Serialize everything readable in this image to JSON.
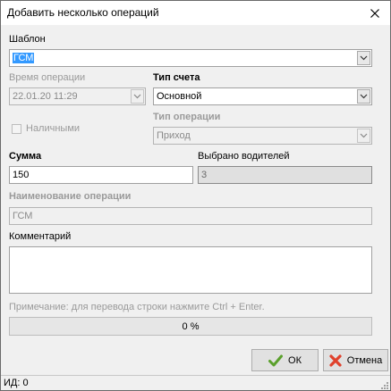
{
  "window": {
    "title": "Добавить несколько операций"
  },
  "template": {
    "label": "Шаблон",
    "value": "ГСМ"
  },
  "operation_time": {
    "label": "Время операции",
    "value": "22.01.20 11:29"
  },
  "account_type": {
    "label": "Тип счета",
    "value": "Основной"
  },
  "cash": {
    "label": "Наличными",
    "checked": false
  },
  "operation_type": {
    "label": "Тип операции",
    "value": "Приход"
  },
  "amount": {
    "label": "Сумма",
    "value": "150"
  },
  "drivers_selected": {
    "label": "Выбрано водителей",
    "value": "3"
  },
  "operation_name": {
    "label": "Наименование операции",
    "value": "ГСМ"
  },
  "comment": {
    "label": "Комментарий",
    "value": ""
  },
  "note": "Примечание: для перевода строки нажмите Ctrl + Enter.",
  "progress": {
    "text": "0 %",
    "value": 0
  },
  "buttons": {
    "ok": "ОК",
    "cancel": "Отмена"
  },
  "status": {
    "id_text": "ИД: 0"
  },
  "colors": {
    "selection": "#3399ff",
    "ok_icon": "#5aa02c",
    "cancel_icon": "#e0412c"
  }
}
